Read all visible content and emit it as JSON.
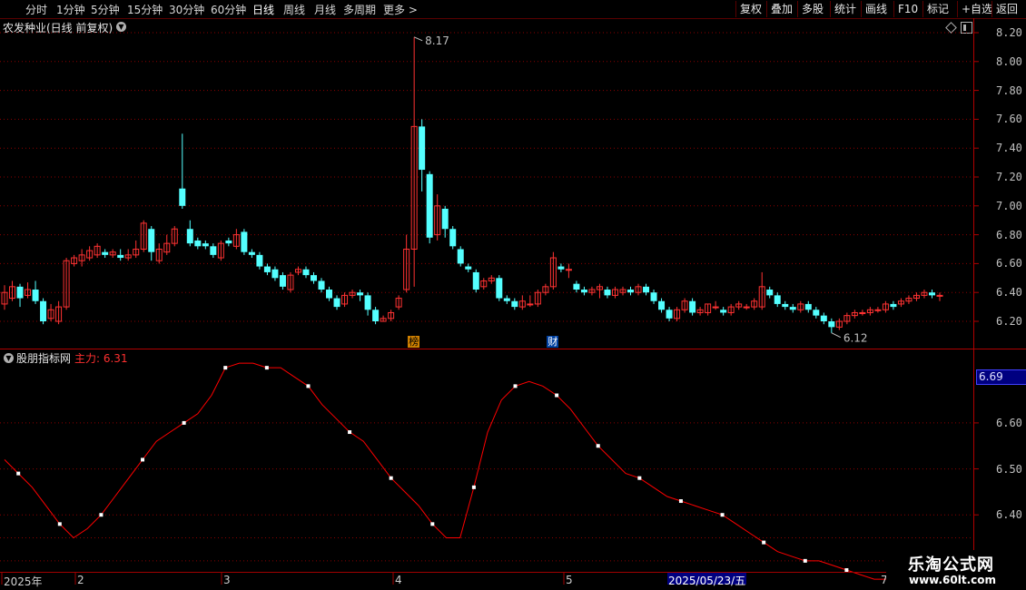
{
  "toolbar": {
    "periods": [
      "分时",
      "1分钟",
      "5分钟",
      "15分钟",
      "30分钟",
      "60分钟",
      "日线",
      "周线",
      "月线",
      "多周期",
      "更多 >"
    ],
    "active_period": "日线",
    "right_buttons": [
      "复权",
      "叠加",
      "多股",
      "统计",
      "画线",
      "F10",
      "标记",
      "+自选",
      "返回"
    ]
  },
  "stock": {
    "title": "农发种业(日线 前复权)"
  },
  "markers": {
    "bang": "榜",
    "cai": "财"
  },
  "price_axis": {
    "ticks": [
      "8.20",
      "8.00",
      "7.80",
      "7.60",
      "7.40",
      "7.20",
      "7.00",
      "6.80",
      "6.60",
      "6.40",
      "6.20"
    ]
  },
  "annotations": {
    "high": "8.17",
    "low": "6.12"
  },
  "indicator": {
    "name": "股朋指标网",
    "value_label": "主力: 6.31",
    "axis_ticks": [
      "6.60",
      "6.50",
      "6.40"
    ],
    "current_value": "6.69"
  },
  "date_axis": {
    "labels": [
      "2025年",
      "2",
      "3",
      "4",
      "5"
    ],
    "highlight": "2025/05/23/五",
    "last": "7"
  },
  "watermark": {
    "line1": "乐淘公式网",
    "line2": "www.60lt.com"
  },
  "colors": {
    "up": "#ff3232",
    "down": "#54ffff",
    "grid": "#8b0000",
    "ma": "#ff0000"
  },
  "chart_data": [
    {
      "type": "candlestick",
      "title": "农发种业(日线 前复权)",
      "ylim": [
        6.1,
        8.25
      ],
      "candles": [
        [
          6.32,
          6.4,
          6.45,
          6.28
        ],
        [
          6.36,
          6.44,
          6.48,
          6.34
        ],
        [
          6.44,
          6.36,
          6.46,
          6.3
        ],
        [
          6.38,
          6.42,
          6.47,
          6.36
        ],
        [
          6.42,
          6.34,
          6.48,
          6.32
        ],
        [
          6.34,
          6.2,
          6.36,
          6.18
        ],
        [
          6.22,
          6.28,
          6.32,
          6.2
        ],
        [
          6.2,
          6.3,
          6.34,
          6.18
        ],
        [
          6.3,
          6.62,
          6.64,
          6.28
        ],
        [
          6.6,
          6.64,
          6.66,
          6.58
        ],
        [
          6.62,
          6.66,
          6.7,
          6.58
        ],
        [
          6.64,
          6.69,
          6.72,
          6.62
        ],
        [
          6.66,
          6.72,
          6.74,
          6.64
        ],
        [
          6.68,
          6.66,
          6.7,
          6.64
        ],
        [
          6.66,
          6.68,
          6.7,
          6.64
        ],
        [
          6.66,
          6.64,
          6.7,
          6.62
        ],
        [
          6.64,
          6.66,
          6.7,
          6.62
        ],
        [
          6.66,
          6.7,
          6.76,
          6.64
        ],
        [
          6.7,
          6.88,
          6.9,
          6.68
        ],
        [
          6.84,
          6.68,
          6.86,
          6.62
        ],
        [
          6.62,
          6.7,
          6.74,
          6.6
        ],
        [
          6.68,
          6.74,
          6.8,
          6.66
        ],
        [
          6.74,
          6.84,
          6.86,
          6.72
        ],
        [
          7.12,
          7.0,
          7.5,
          6.98
        ],
        [
          6.84,
          6.74,
          6.9,
          6.72
        ],
        [
          6.76,
          6.72,
          6.78,
          6.7
        ],
        [
          6.74,
          6.72,
          6.76,
          6.7
        ],
        [
          6.72,
          6.66,
          6.74,
          6.64
        ],
        [
          6.64,
          6.74,
          6.76,
          6.62
        ],
        [
          6.76,
          6.74,
          6.78,
          6.72
        ],
        [
          6.72,
          6.8,
          6.84,
          6.7
        ],
        [
          6.82,
          6.68,
          6.84,
          6.66
        ],
        [
          6.68,
          6.66,
          6.7,
          6.64
        ],
        [
          6.66,
          6.58,
          6.68,
          6.56
        ],
        [
          6.58,
          6.54,
          6.6,
          6.52
        ],
        [
          6.56,
          6.5,
          6.58,
          6.48
        ],
        [
          6.52,
          6.44,
          6.54,
          6.42
        ],
        [
          6.42,
          6.52,
          6.54,
          6.4
        ],
        [
          6.54,
          6.56,
          6.58,
          6.52
        ],
        [
          6.56,
          6.52,
          6.58,
          6.5
        ],
        [
          6.52,
          6.48,
          6.54,
          6.46
        ],
        [
          6.48,
          6.42,
          6.5,
          6.4
        ],
        [
          6.42,
          6.36,
          6.44,
          6.34
        ],
        [
          6.36,
          6.3,
          6.38,
          6.28
        ],
        [
          6.32,
          6.38,
          6.4,
          6.3
        ],
        [
          6.38,
          6.4,
          6.42,
          6.36
        ],
        [
          6.4,
          6.38,
          6.42,
          6.34
        ],
        [
          6.38,
          6.28,
          6.4,
          6.24
        ],
        [
          6.28,
          6.2,
          6.3,
          6.18
        ],
        [
          6.2,
          6.22,
          6.24,
          6.2
        ],
        [
          6.22,
          6.26,
          6.28,
          6.2
        ],
        [
          6.3,
          6.36,
          6.38,
          6.28
        ],
        [
          6.42,
          6.7,
          6.8,
          6.4
        ],
        [
          6.7,
          7.55,
          8.17,
          6.44
        ],
        [
          7.55,
          7.25,
          7.6,
          7.1
        ],
        [
          7.22,
          6.78,
          7.24,
          6.74
        ],
        [
          6.8,
          7.0,
          7.08,
          6.76
        ],
        [
          6.98,
          6.84,
          7.0,
          6.78
        ],
        [
          6.84,
          6.72,
          6.86,
          6.7
        ],
        [
          6.7,
          6.6,
          6.72,
          6.58
        ],
        [
          6.58,
          6.56,
          6.6,
          6.54
        ],
        [
          6.54,
          6.42,
          6.56,
          6.4
        ],
        [
          6.44,
          6.48,
          6.5,
          6.42
        ],
        [
          6.48,
          6.5,
          6.52,
          6.46
        ],
        [
          6.5,
          6.36,
          6.52,
          6.34
        ],
        [
          6.36,
          6.34,
          6.38,
          6.32
        ],
        [
          6.34,
          6.3,
          6.36,
          6.28
        ],
        [
          6.3,
          6.34,
          6.38,
          6.28
        ],
        [
          6.32,
          6.32,
          6.38,
          6.3
        ],
        [
          6.32,
          6.4,
          6.42,
          6.3
        ],
        [
          6.4,
          6.44,
          6.46,
          6.38
        ],
        [
          6.44,
          6.64,
          6.68,
          6.42
        ],
        [
          6.58,
          6.56,
          6.6,
          6.54
        ],
        [
          6.56,
          6.56,
          6.6,
          6.5
        ],
        [
          6.46,
          6.42,
          6.48,
          6.4
        ],
        [
          6.42,
          6.4,
          6.44,
          6.38
        ],
        [
          6.4,
          6.42,
          6.44,
          6.38
        ],
        [
          6.42,
          6.44,
          6.46,
          6.36
        ],
        [
          6.42,
          6.38,
          6.44,
          6.36
        ],
        [
          6.38,
          6.42,
          6.44,
          6.36
        ],
        [
          6.4,
          6.42,
          6.44,
          6.38
        ],
        [
          6.42,
          6.4,
          6.44,
          6.38
        ],
        [
          6.4,
          6.44,
          6.46,
          6.38
        ],
        [
          6.44,
          6.4,
          6.46,
          6.38
        ],
        [
          6.4,
          6.34,
          6.42,
          6.32
        ],
        [
          6.34,
          6.28,
          6.36,
          6.26
        ],
        [
          6.28,
          6.22,
          6.3,
          6.2
        ],
        [
          6.22,
          6.28,
          6.3,
          6.2
        ],
        [
          6.28,
          6.34,
          6.36,
          6.26
        ],
        [
          6.34,
          6.26,
          6.36,
          6.24
        ],
        [
          6.26,
          6.28,
          6.3,
          6.24
        ],
        [
          6.26,
          6.32,
          6.32,
          6.24
        ],
        [
          6.3,
          6.3,
          6.34,
          6.28
        ],
        [
          6.28,
          6.26,
          6.3,
          6.24
        ],
        [
          6.26,
          6.3,
          6.32,
          6.24
        ],
        [
          6.3,
          6.32,
          6.34,
          6.28
        ],
        [
          6.3,
          6.3,
          6.32,
          6.28
        ],
        [
          6.3,
          6.34,
          6.36,
          6.28
        ],
        [
          6.3,
          6.44,
          6.54,
          6.28
        ],
        [
          6.42,
          6.38,
          6.44,
          6.36
        ],
        [
          6.38,
          6.32,
          6.4,
          6.3
        ],
        [
          6.32,
          6.3,
          6.34,
          6.28
        ],
        [
          6.3,
          6.28,
          6.32,
          6.26
        ],
        [
          6.28,
          6.32,
          6.34,
          6.26
        ],
        [
          6.32,
          6.28,
          6.34,
          6.26
        ],
        [
          6.28,
          6.24,
          6.3,
          6.22
        ],
        [
          6.24,
          6.2,
          6.26,
          6.18
        ],
        [
          6.2,
          6.16,
          6.22,
          6.12
        ],
        [
          6.16,
          6.2,
          6.22,
          6.14
        ],
        [
          6.2,
          6.24,
          6.26,
          6.18
        ],
        [
          6.24,
          6.26,
          6.28,
          6.22
        ],
        [
          6.26,
          6.26,
          6.28,
          6.24
        ],
        [
          6.26,
          6.28,
          6.3,
          6.24
        ],
        [
          6.28,
          6.28,
          6.3,
          6.26
        ],
        [
          6.28,
          6.32,
          6.34,
          6.26
        ],
        [
          6.32,
          6.3,
          6.34,
          6.28
        ],
        [
          6.32,
          6.34,
          6.36,
          6.3
        ],
        [
          6.34,
          6.36,
          6.38,
          6.32
        ],
        [
          6.36,
          6.38,
          6.4,
          6.34
        ],
        [
          6.38,
          6.4,
          6.42,
          6.36
        ],
        [
          6.4,
          6.38,
          6.42,
          6.36
        ],
        [
          6.38,
          6.38,
          6.4,
          6.34
        ]
      ]
    },
    {
      "type": "line",
      "title": "股朋指标网",
      "series": [
        {
          "name": "主力",
          "values": [
            6.52,
            6.49,
            6.46,
            6.42,
            6.38,
            6.35,
            6.37,
            6.4,
            6.44,
            6.48,
            6.52,
            6.56,
            6.58,
            6.6,
            6.62,
            6.66,
            6.72,
            6.73,
            6.73,
            6.72,
            6.72,
            6.7,
            6.68,
            6.64,
            6.61,
            6.58,
            6.56,
            6.52,
            6.48,
            6.45,
            6.42,
            6.38,
            6.35,
            6.35,
            6.46,
            6.58,
            6.65,
            6.68,
            6.69,
            6.68,
            6.66,
            6.63,
            6.59,
            6.55,
            6.52,
            6.49,
            6.48,
            6.46,
            6.44,
            6.43,
            6.42,
            6.41,
            6.4,
            6.38,
            6.36,
            6.34,
            6.32,
            6.31,
            6.3,
            6.3,
            6.29,
            6.28,
            6.27,
            6.26,
            6.26
          ]
        }
      ],
      "ylim": [
        6.28,
        6.74
      ]
    }
  ]
}
